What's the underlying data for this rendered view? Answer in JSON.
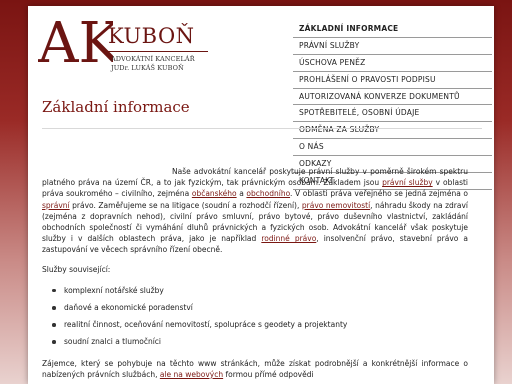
{
  "logo": {
    "initials": "AK",
    "name": "KUBOŇ",
    "subtitle_1": "ADVOKÁTNÍ KANCELÁŘ",
    "subtitle_2": "JUDr. LUKÁŠ KUBOŇ"
  },
  "nav": {
    "items": [
      {
        "label": "ZÁKLADNÍ INFORMACE",
        "active": true
      },
      {
        "label": "PRÁVNÍ SLUŽBY"
      },
      {
        "label": "ÚSCHOVA PENĚZ"
      },
      {
        "label": "PROHLÁŠENÍ O PRAVOSTI PODPISU"
      },
      {
        "label": "AUTORIZOVANÁ KONVERZE DOKUMENTŮ"
      },
      {
        "label": "SPOTŘEBITELÉ, OSOBNÍ ÚDAJE"
      },
      {
        "label": "ODMĚNA ZA SLUŽBY"
      },
      {
        "label": "O NÁS"
      },
      {
        "label": "ODKAZY"
      },
      {
        "label": "KONTAKT"
      }
    ]
  },
  "main": {
    "title": "Základní informace",
    "p1": {
      "t1": "Naše advokátní kancelář poskytuje právní služby v poměrně širokém spektru platného práva na území ČR, a to jak fyzickým, tak právnickým osobám. Základem jsou ",
      "link1": "právní služby",
      "t2": " v oblasti práva soukromého – civilního, zejména ",
      "link2": "občanského",
      "t3": " a ",
      "link3": "obchodního",
      "t4": ". V oblasti práva veřejného se jedná zejména o ",
      "link4": "správní",
      "t5": " právo. Zaměřujeme se na litigace (soudní a rozhodčí řízení), ",
      "link5": "právo nemovitostí",
      "t6": ", náhradu škody na zdraví (zejména z dopravních nehod), civilní právo smluvní, právo bytové, právo duševního vlastnictví, zakládání obchodních společností či vymáhání dluhů právnických a fyzických osob. Advokátní kancelář však poskytuje služby i v dalších oblastech práva, jako je například ",
      "link6": "rodinné právo",
      "t7": ", insolvenční právo, stavební právo a zastupování ve věcech správního řízení obecně."
    },
    "services_intro": "Služby související:",
    "services": [
      "komplexní notářské služby",
      "daňové a ekonomické poradenství",
      "realitní činnost, oceňování nemovitostí, spolupráce s geodety a projektanty",
      "soudní znalci a tlumočníci"
    ],
    "p_last": {
      "t1": "Zájemce, který se pohybuje na těchto www stránkách, může získat podrobnější a konkrétnější informace o nabízených právních službách, ",
      "link1": "ale na webových",
      "t2": " formou přímé odpovědi"
    }
  }
}
